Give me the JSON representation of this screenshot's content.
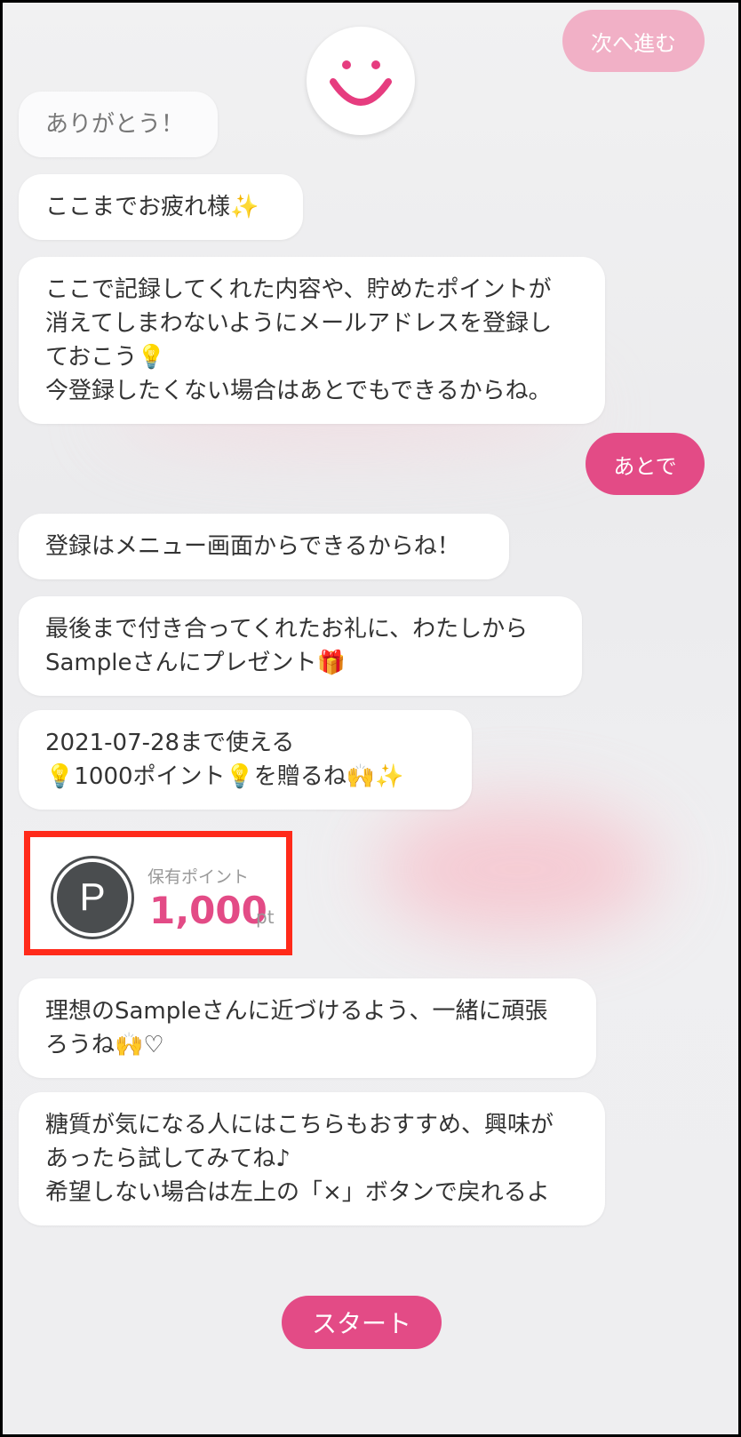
{
  "header": {
    "next_label": "次へ進む"
  },
  "messages": [
    "ありがとう！",
    "ここまでお疲れ様✨",
    "ここで記録してくれた内容や、貯めたポイントが\n消えてしまわないようにメールアドレスを登録し\nておこう💡\n今登録したくない場合はあとでもできるからね。",
    "登録はメニュー画面からできるからね！",
    "最後まで付き合ってくれたお礼に、わたしから\nSampleさんにプレゼント🎁",
    "2021-07-28まで使える\n💡1000ポイント💡を贈るね🙌✨",
    "理想のSampleさんに近づけるよう、一緒に頑張\nろうね🙌♡",
    "糖質が気になる人にはこちらもおすすめ、興味が\nあったら試してみてね♪\n希望しない場合は左上の「×」ボタンで戻れるよ"
  ],
  "reply": {
    "label": "あとで"
  },
  "points": {
    "icon_letter": "P",
    "label": "保有ポイント",
    "value": "1,000",
    "unit": "pt"
  },
  "footer": {
    "start_label": "スタート"
  },
  "icons": {
    "avatar": "smiley-face-icon",
    "points": "points-p-icon"
  },
  "colors": {
    "accent": "#e34b86",
    "accent_light": "#f1b0c6",
    "highlight_border": "#ff2a1a",
    "points_icon": "#4a4d4f"
  }
}
